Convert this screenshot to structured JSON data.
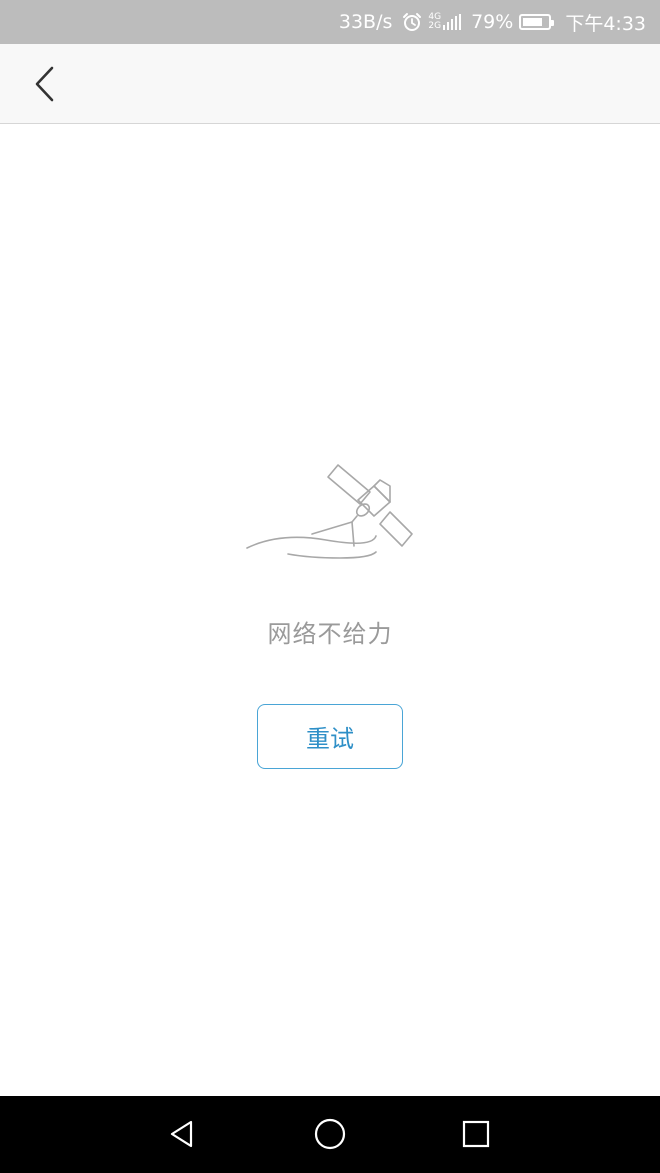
{
  "status_bar": {
    "net_speed": "33B/s",
    "network_type_top": "4G",
    "network_type_bottom": "2G",
    "battery_percent": "79%",
    "battery_level": 0.79,
    "time": "下午4:33"
  },
  "toolbar": {
    "back_icon": "chevron-left-icon"
  },
  "empty_state": {
    "illustration": "satellite-icon",
    "message": "网络不给力",
    "retry_label": "重试"
  },
  "colors": {
    "status_bar_bg": "#bcbcbc",
    "toolbar_bg": "#f8f8f8",
    "accent": "#2e8fc7",
    "message_text": "#9a9a9a",
    "nav_bar_bg": "#000000"
  },
  "nav_bar": {
    "back_icon": "triangle-back-icon",
    "home_icon": "circle-home-icon",
    "recents_icon": "square-recents-icon"
  }
}
